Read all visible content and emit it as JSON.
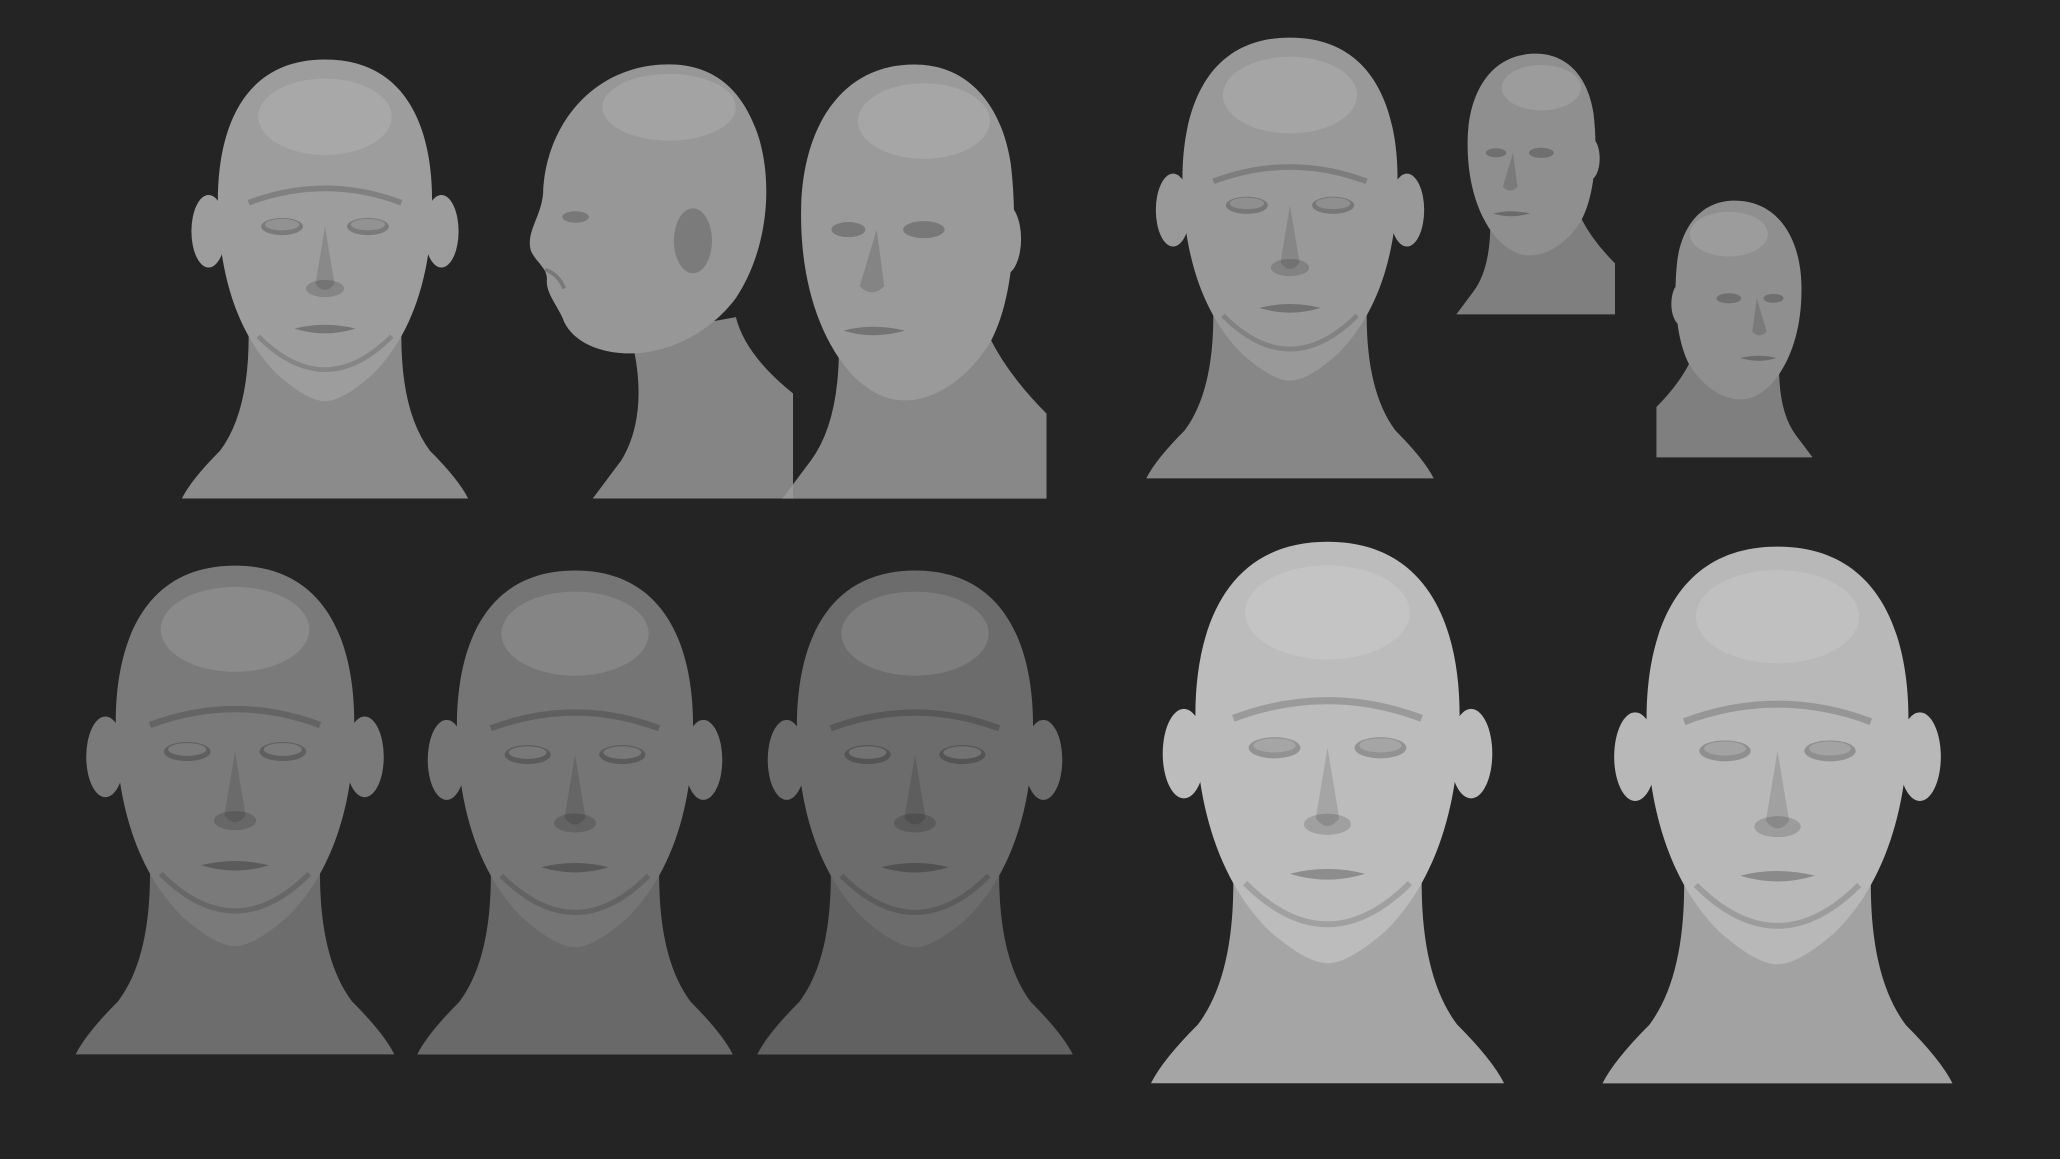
{
  "image": {
    "description_kind": "sculpt-render-sheet",
    "background_color": "#242424",
    "clay_color_mid": "#9a9a9a",
    "clay_color_dark": "#6e6e6e",
    "clay_color_light": "#c8c8c8"
  },
  "groups": [
    {
      "name": "top-left-turnaround",
      "views": [
        "front",
        "profile-left",
        "three-quarter-right"
      ]
    },
    {
      "name": "top-right-set",
      "views": [
        "front",
        "three-quarter-right",
        "three-quarter-left"
      ]
    },
    {
      "name": "bottom-left-progression",
      "views": [
        "front-base",
        "front-refined",
        "front-detailed"
      ]
    },
    {
      "name": "bottom-right-closeups",
      "views": [
        "front-bright",
        "front-bright-detailed"
      ]
    }
  ]
}
